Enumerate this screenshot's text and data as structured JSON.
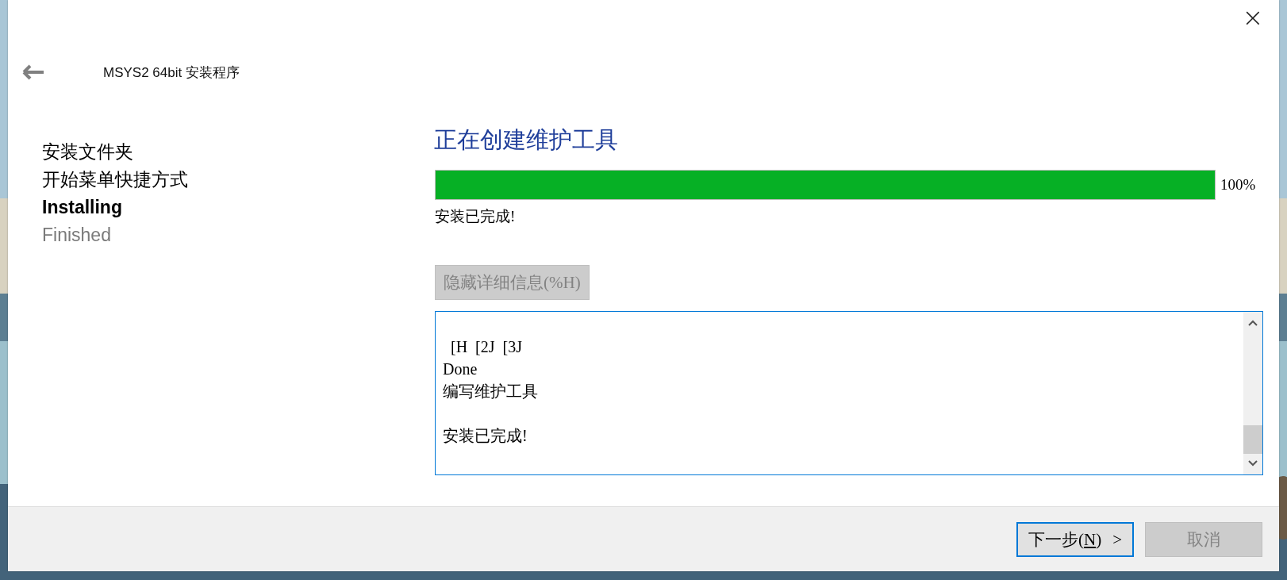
{
  "window": {
    "title": "MSYS2 64bit 安装程序",
    "close_glyph": "×"
  },
  "steps": [
    {
      "label": "安装文件夹",
      "kind": "done"
    },
    {
      "label": "开始菜单快捷方式",
      "kind": "done"
    },
    {
      "label": "Installing",
      "kind": "current"
    },
    {
      "label": "Finished",
      "kind": "pending"
    }
  ],
  "page": {
    "heading": "正在创建维护工具",
    "progress": {
      "level": 1.0,
      "reading": "100%"
    },
    "status": "安装已完成!"
  },
  "details_button": {
    "label": "隐藏详细信息(%H)",
    "disabled": true
  },
  "log": {
    "lines": [
      {
        "text": "  [H  [2J  [3J",
        "gap_before": true
      },
      {
        "text": "Done",
        "gap_before": false
      },
      {
        "text": "编写维护工具",
        "gap_before": false
      },
      {
        "text": "安装已完成!",
        "gap_before": true
      }
    ]
  },
  "footer": {
    "next_button": {
      "label_before": "下一步(",
      "mnemonic": "N",
      "label_after": ")",
      "arrow": ">",
      "focused": true,
      "disabled": false
    },
    "cancel_button": {
      "label": "取消",
      "disabled": true
    }
  }
}
